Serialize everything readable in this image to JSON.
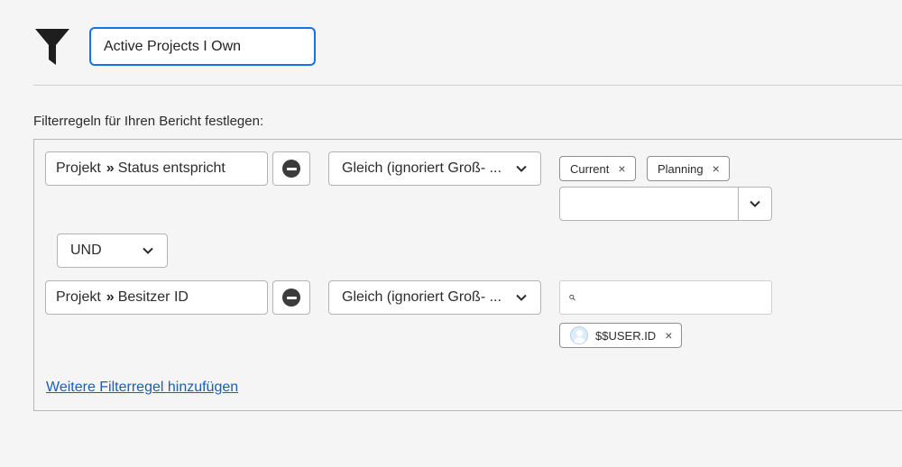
{
  "report_name": {
    "value": "Active Projects I Own"
  },
  "rules_label": "Filterregeln für Ihren Bericht festlegen:",
  "rule1": {
    "field_object": "Projekt",
    "field_separator": "»",
    "field_name": "Status entspricht",
    "operator": "Gleich (ignoriert Groß- ...",
    "values": [
      {
        "label": "Current",
        "remove": "×"
      },
      {
        "label": "Planning",
        "remove": "×"
      }
    ],
    "combo_value": ""
  },
  "conjunction": "UND",
  "rule2": {
    "field_object": "Projekt",
    "field_separator": "»",
    "field_name": "Besitzer ID",
    "operator": "Gleich (ignoriert Groß- ...",
    "search_value": "",
    "values": [
      {
        "label": "$$USER.ID",
        "remove": "×"
      }
    ]
  },
  "add_rule_link": "Weitere Filterregel hinzufügen",
  "icons": {
    "filter": "filter-icon",
    "remove_rule": "minus-circle-icon",
    "dropdown": "chevron-down-icon",
    "search": "search-icon",
    "user": "user-avatar-icon"
  },
  "colors": {
    "focus_border": "#1473e6",
    "link": "#1a5fb4"
  }
}
